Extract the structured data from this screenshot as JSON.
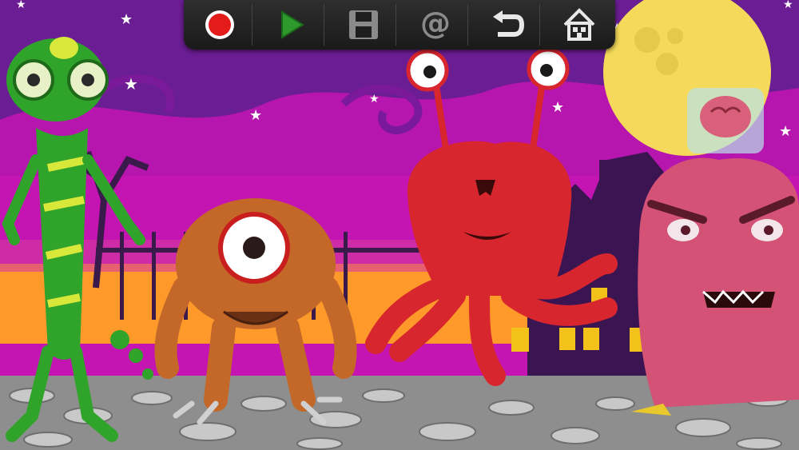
{
  "toolbar": {
    "buttons": [
      {
        "name": "record",
        "icon": "record-icon",
        "color": "#e41b1b"
      },
      {
        "name": "play",
        "icon": "play-icon",
        "color": "#2e9a2e"
      },
      {
        "name": "save",
        "icon": "save-icon",
        "color": "#8a8a8a"
      },
      {
        "name": "share",
        "icon": "at-icon",
        "color": "#8a8a8a"
      },
      {
        "name": "undo",
        "icon": "undo-icon",
        "color": "#e8e8e8"
      },
      {
        "name": "home",
        "icon": "home-icon",
        "color": "#e8e8e8"
      }
    ]
  },
  "scene": {
    "sky_color": "#d21bb4",
    "night_color": "#5a1a8a",
    "moon_color": "#f4d95a",
    "ground_color": "#9a9a9a"
  },
  "characters": [
    {
      "name": "green-lizard-monster",
      "color": "#2fa32a"
    },
    {
      "name": "cyclops-monster",
      "color": "#c4682a"
    },
    {
      "name": "red-octopus-monster",
      "color": "#d8262e"
    },
    {
      "name": "pink-furry-monster",
      "color": "#d45276"
    }
  ]
}
